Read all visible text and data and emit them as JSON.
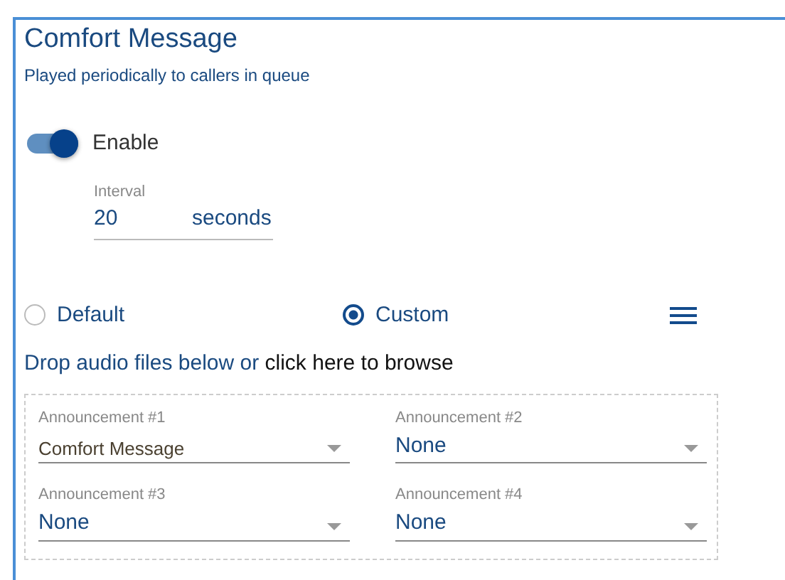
{
  "title": "Comfort Message",
  "subtitle": "Played periodically to callers in queue",
  "enable": {
    "label": "Enable",
    "on": true
  },
  "interval": {
    "label": "Interval",
    "value": "20",
    "unit": "seconds"
  },
  "source": [
    {
      "label": "Default",
      "selected": false
    },
    {
      "label": "Custom",
      "selected": true
    }
  ],
  "drop_text": "Drop audio files below or ",
  "browse_link": "click here to browse",
  "announcements": [
    {
      "label": "Announcement #1",
      "value": "Comfort Message",
      "kind": "file"
    },
    {
      "label": "Announcement #2",
      "value": "None",
      "kind": "empty"
    },
    {
      "label": "Announcement #3",
      "value": "None",
      "kind": "empty"
    },
    {
      "label": "Announcement #4",
      "value": "None",
      "kind": "empty"
    }
  ]
}
